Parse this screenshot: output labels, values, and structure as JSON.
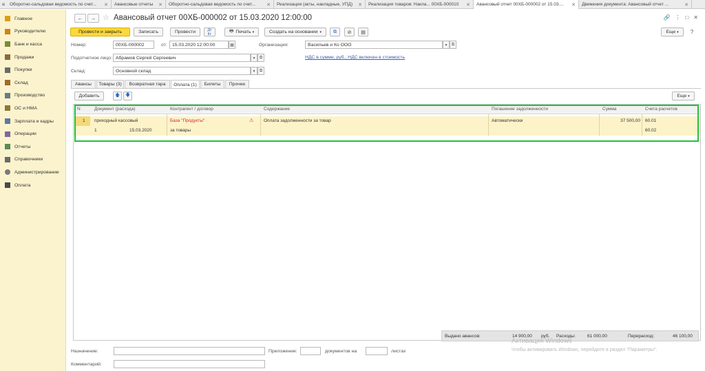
{
  "tabs": [
    {
      "label": "Оборотно-сальдовая ведомость по счет..."
    },
    {
      "label": "Авансовые отчеты"
    },
    {
      "label": "Оборотно-сальдовая ведомость по счет..."
    },
    {
      "label": "Реализация (акты, накладные, УПД)"
    },
    {
      "label": "Реализация товаров: Накла... 00ХБ-000010"
    },
    {
      "label": "Авансовый отчет 00ХБ-000002 от 15.03...."
    },
    {
      "label": "Движения документа: Авансовый отчет ..."
    }
  ],
  "sidebar": {
    "items": [
      {
        "label": "Главное",
        "color": "#d99f1a"
      },
      {
        "label": "Руководителю",
        "color": "#c9851a"
      },
      {
        "label": "Банк и касса",
        "color": "#7a8a3a"
      },
      {
        "label": "Продажи",
        "color": "#8a6a3a"
      },
      {
        "label": "Покупки",
        "color": "#6a6a6a"
      },
      {
        "label": "Склад",
        "color": "#a06a2a"
      },
      {
        "label": "Производство",
        "color": "#6a7a8a"
      },
      {
        "label": "ОС и НМА",
        "color": "#8a7a3a"
      },
      {
        "label": "Зарплата и кадры",
        "color": "#5a7aa0"
      },
      {
        "label": "Операции",
        "color": "#7a6a9a"
      },
      {
        "label": "Отчеты",
        "color": "#5a8a5a"
      },
      {
        "label": "Справочники",
        "color": "#6a6a6a"
      },
      {
        "label": "Администрирование",
        "color": "#7a7a7a"
      },
      {
        "label": "Оплата",
        "color": "#4a4a4a"
      }
    ]
  },
  "doc": {
    "title": "Авансовый отчет 00ХБ-000002 от 15.03.2020 12:00:00",
    "toolbar": {
      "post_close": "Провести и закрыть",
      "save": "Записать",
      "post": "Провести",
      "print": "Печать",
      "create_based": "Создать на основании",
      "more": "Еще"
    },
    "fields": {
      "number_label": "Номер:",
      "number_value": "00ХБ-000002",
      "date_label": "от:",
      "date_value": "15.03.2020 12:00:00",
      "org_label": "Организация:",
      "org_value": "Васильев и Ко ООО",
      "person_label": "Подотчетное лицо:",
      "person_value": "Абрамов Сергей Сергеевич",
      "vat_link": "НДС в сумме, руб., НДС включен в стоимость",
      "warehouse_label": "Склад:",
      "warehouse_value": "Основной склад"
    },
    "doc_tabs": [
      {
        "label": "Авансы"
      },
      {
        "label": "Товары (3)"
      },
      {
        "label": "Возвратная тара"
      },
      {
        "label": "Оплата (1)"
      },
      {
        "label": "Билеты"
      },
      {
        "label": "Прочее"
      }
    ],
    "table_toolbar": {
      "add": "Добавить",
      "up_arrow": "🡅",
      "down_arrow": "🡇",
      "more": "Еще"
    },
    "table": {
      "headers": [
        "N",
        "Документ (расхода)",
        "Контрагент / договор",
        "Содержание",
        "Погашение задолженности",
        "Сумма",
        "Счета расчетов"
      ],
      "row1": {
        "n": "1",
        "doc": "приходный кассовый",
        "counterparty": "База \"Продукты\"",
        "content": "Оплата задолженности за товар",
        "repayment": "Автоматически",
        "sum": "37 500,00",
        "account": "60.01"
      },
      "row2": {
        "doc_n": "1",
        "doc_date": "15.03.2020",
        "contract": "за товары",
        "account": "60.02"
      }
    },
    "totals": {
      "advance_label": "Выдано авансов:",
      "advance_value": "14 900,00",
      "currency": "руб.",
      "expense_label": "Расходы:",
      "expense_value": "61 000,00",
      "overspend_label": "Перерасход:",
      "overspend_value": "46 100,00"
    },
    "bottom": {
      "purpose_label": "Назначение:",
      "attachment_label": "Приложение:",
      "docs_on": "документов на",
      "sheets": "листах",
      "comment_label": "Комментарий:"
    }
  },
  "watermark": {
    "line1": "Активация Windows",
    "line2": "Чтобы активировать Windows, перейдите в раздел \"Параметры\"."
  }
}
